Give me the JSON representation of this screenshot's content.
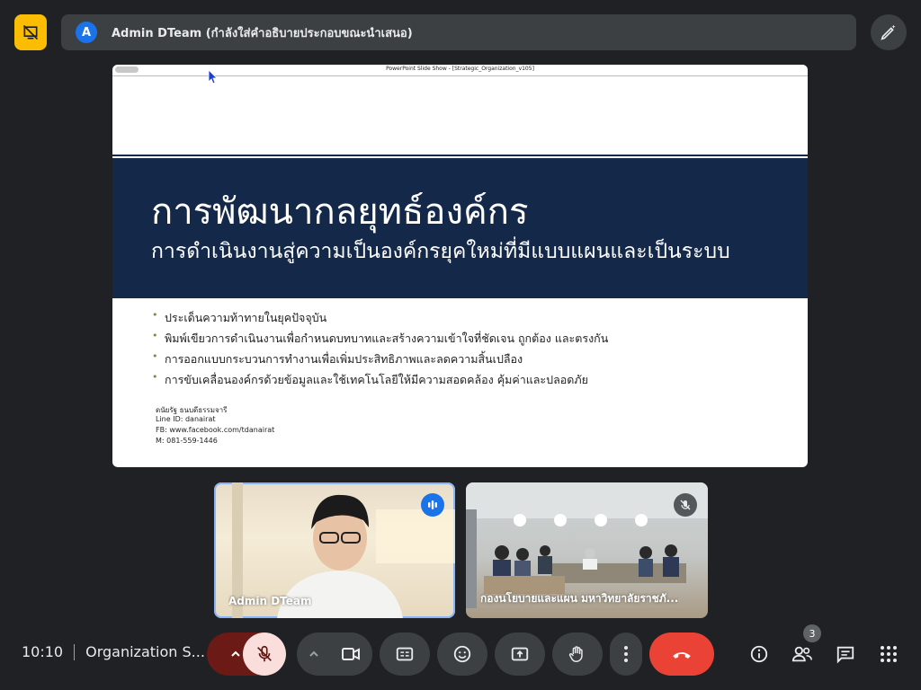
{
  "presenter": {
    "avatar_letter": "A",
    "text": "Admin DTeam (กำลังใส่คำอธิบายประกอบขณะนำเสนอ)"
  },
  "slide": {
    "window_caption": "PowerPoint Slide Show - [Strategic_Organization_v105]",
    "title": "การพัฒนากลยุทธ์องค์กร",
    "subtitle": "การดำเนินงานสู่ความเป็นองค์กรยุคใหม่ที่มีแบบแผนและเป็นระบบ",
    "bullets": [
      "ประเด็นความท้าทายในยุคปัจจุบัน",
      "พิมพ์เขียวการดำเนินงานเพื่อกำหนดบทบาทและสร้างความเข้าใจที่ชัดเจน ถูกต้อง และตรงกัน",
      "การออกแบบกระบวนการทำงานเพื่อเพิ่มประสิทธิภาพและลดความสิ้นเปลือง",
      "การขับเคลื่อนองค์กรด้วยข้อมูลและใช้เทคโนโลยีให้มีความสอดคล้อง คุ้มค่าและปลอดภัย"
    ],
    "contact": [
      "ดนัยรัฐ ธนบดีธรรมจารี",
      "Line ID: danairat",
      "FB: www.facebook.com/tdanairat",
      "M:  081-559-1446"
    ]
  },
  "participants": [
    {
      "name": "Admin DTeam",
      "status": "speaking"
    },
    {
      "name": "กองนโยบายและแผน มหาวิทยาลัยราชภั...",
      "status": "muted"
    }
  ],
  "meeting": {
    "time": "10:10",
    "title": "Organization S...",
    "participant_count": "3"
  },
  "colors": {
    "accent_blue": "#1a73e8",
    "end_call_red": "#ea4335",
    "warning_yellow": "#fbbc04",
    "slide_band": "#142849"
  }
}
